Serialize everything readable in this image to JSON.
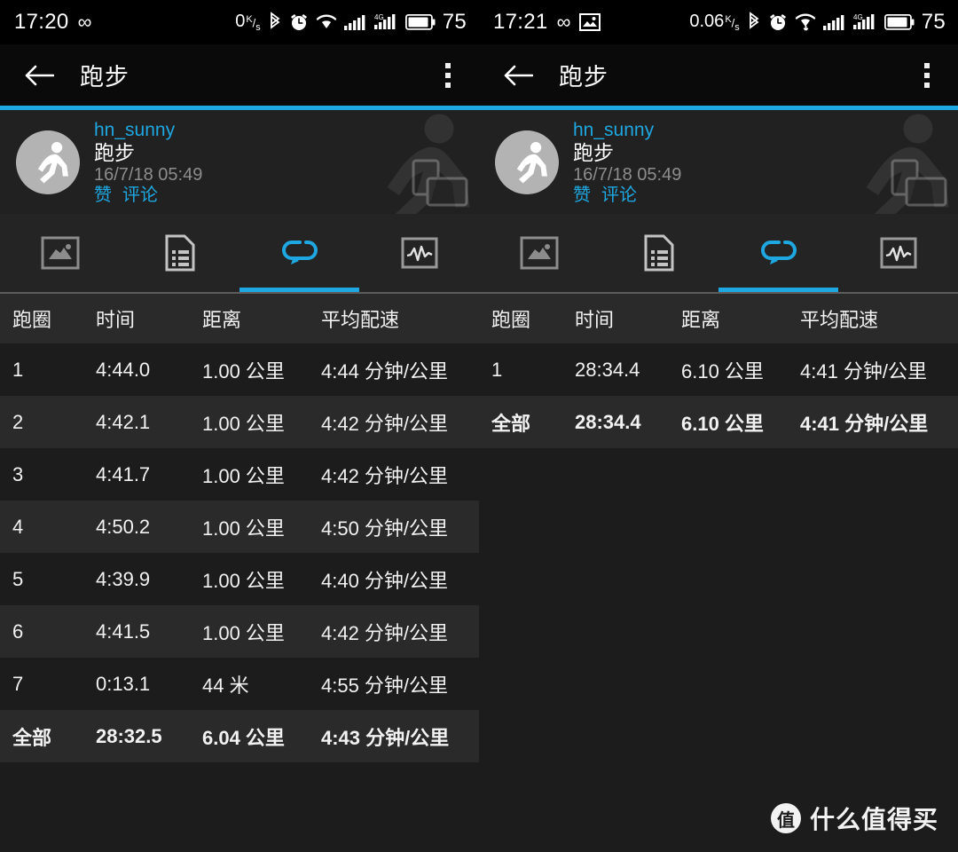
{
  "panels": [
    {
      "status": {
        "time": "17:20",
        "infinity": "∞",
        "gallery_icon": false,
        "net_rate": "0",
        "net_unit_top": "K",
        "net_unit_bottom": "s",
        "battery": "75",
        "icons": [
          "bluetooth-icon",
          "alarm-icon",
          "wifi-icon",
          "signal-icon",
          "4g-signal-icon",
          "battery-icon"
        ]
      },
      "appbar": {
        "title": "跑步",
        "back_icon": "back-arrow-icon",
        "overflow_icon": "overflow-menu-icon"
      },
      "activity": {
        "user": "hn_sunny",
        "title": "跑步",
        "date": "16/7/18 05:49",
        "like": "赞",
        "comment": "评论",
        "avatar_icon": "runner-avatar-icon",
        "cast_icon": "screen-cast-icon"
      },
      "tabs": [
        {
          "name": "map-tab",
          "icon": "map-icon",
          "active": false
        },
        {
          "name": "details-tab",
          "icon": "document-list-icon",
          "active": false
        },
        {
          "name": "laps-tab",
          "icon": "lap-loop-icon",
          "active": true
        },
        {
          "name": "graph-tab",
          "icon": "chart-waveform-icon",
          "active": false
        }
      ],
      "table": {
        "headers": [
          "跑圈",
          "时间",
          "距离",
          "平均配速"
        ],
        "rows": [
          [
            "1",
            "4:44.0",
            "1.00 公里",
            "4:44 分钟/公里"
          ],
          [
            "2",
            "4:42.1",
            "1.00 公里",
            "4:42 分钟/公里"
          ],
          [
            "3",
            "4:41.7",
            "1.00 公里",
            "4:42 分钟/公里"
          ],
          [
            "4",
            "4:50.2",
            "1.00 公里",
            "4:50 分钟/公里"
          ],
          [
            "5",
            "4:39.9",
            "1.00 公里",
            "4:40 分钟/公里"
          ],
          [
            "6",
            "4:41.5",
            "1.00 公里",
            "4:42 分钟/公里"
          ],
          [
            "7",
            "0:13.1",
            "44 米",
            "4:55 分钟/公里"
          ]
        ],
        "total": [
          "全部",
          "28:32.5",
          "6.04 公里",
          "4:43 分钟/公里"
        ]
      }
    },
    {
      "status": {
        "time": "17:21",
        "infinity": "∞",
        "gallery_icon": true,
        "net_rate": "0.06",
        "net_unit_top": "K",
        "net_unit_bottom": "s",
        "battery": "75",
        "icons": [
          "bluetooth-icon",
          "alarm-icon",
          "wifi-icon",
          "signal-icon",
          "4g-signal-icon",
          "battery-icon"
        ]
      },
      "appbar": {
        "title": "跑步",
        "back_icon": "back-arrow-icon",
        "overflow_icon": "overflow-menu-icon"
      },
      "activity": {
        "user": "hn_sunny",
        "title": "跑步",
        "date": "16/7/18 05:49",
        "like": "赞",
        "comment": "评论",
        "avatar_icon": "runner-avatar-icon",
        "cast_icon": "screen-cast-icon"
      },
      "tabs": [
        {
          "name": "map-tab",
          "icon": "map-icon",
          "active": false
        },
        {
          "name": "details-tab",
          "icon": "document-list-icon",
          "active": false
        },
        {
          "name": "laps-tab",
          "icon": "lap-loop-icon",
          "active": true
        },
        {
          "name": "graph-tab",
          "icon": "chart-waveform-icon",
          "active": false
        }
      ],
      "table": {
        "headers": [
          "跑圈",
          "时间",
          "距离",
          "平均配速"
        ],
        "rows": [
          [
            "1",
            "28:34.4",
            "6.10 公里",
            "4:41 分钟/公里"
          ]
        ],
        "total": [
          "全部",
          "28:34.4",
          "6.10 公里",
          "4:41 分钟/公里"
        ]
      }
    }
  ],
  "watermark": {
    "badge": "值",
    "text": "什么值得买"
  },
  "colors": {
    "accent": "#1ea7e1",
    "row_alt": "#2a2a2a",
    "row_base": "#1c1c1c",
    "muted": "#9a9a9a"
  }
}
